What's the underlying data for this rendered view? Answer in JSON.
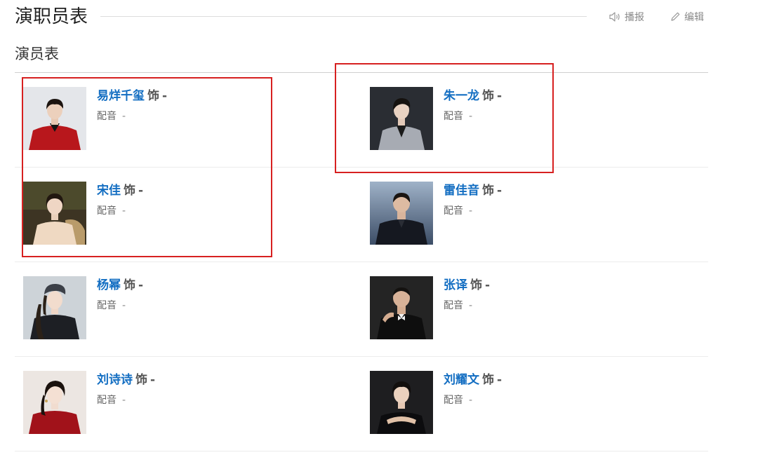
{
  "header": {
    "title": "演职员表",
    "report_label": "播报",
    "edit_label": "编辑"
  },
  "cast": {
    "subtitle": "演员表",
    "members": [
      {
        "actor": "易烊千玺",
        "role_prefix": "饰",
        "role": "-",
        "voice_label": "配音",
        "voice": "-"
      },
      {
        "actor": "朱一龙",
        "role_prefix": "饰",
        "role": "-",
        "voice_label": "配音",
        "voice": "-"
      },
      {
        "actor": "宋佳",
        "role_prefix": "饰",
        "role": "-",
        "voice_label": "配音",
        "voice": "-"
      },
      {
        "actor": "雷佳音",
        "role_prefix": "饰",
        "role": "-",
        "voice_label": "配音",
        "voice": "-"
      },
      {
        "actor": "杨幂",
        "role_prefix": "饰",
        "role": "-",
        "voice_label": "配音",
        "voice": "-"
      },
      {
        "actor": "张译",
        "role_prefix": "饰",
        "role": "-",
        "voice_label": "配音",
        "voice": "-"
      },
      {
        "actor": "刘诗诗",
        "role_prefix": "饰",
        "role": "-",
        "voice_label": "配音",
        "voice": "-"
      },
      {
        "actor": "刘耀文",
        "role_prefix": "饰",
        "role": "-",
        "voice_label": "配音",
        "voice": "-"
      }
    ]
  },
  "colors": {
    "link": "#136ec2",
    "annotation": "#d72020"
  },
  "icons": [
    "speaker-icon",
    "pencil-icon"
  ]
}
